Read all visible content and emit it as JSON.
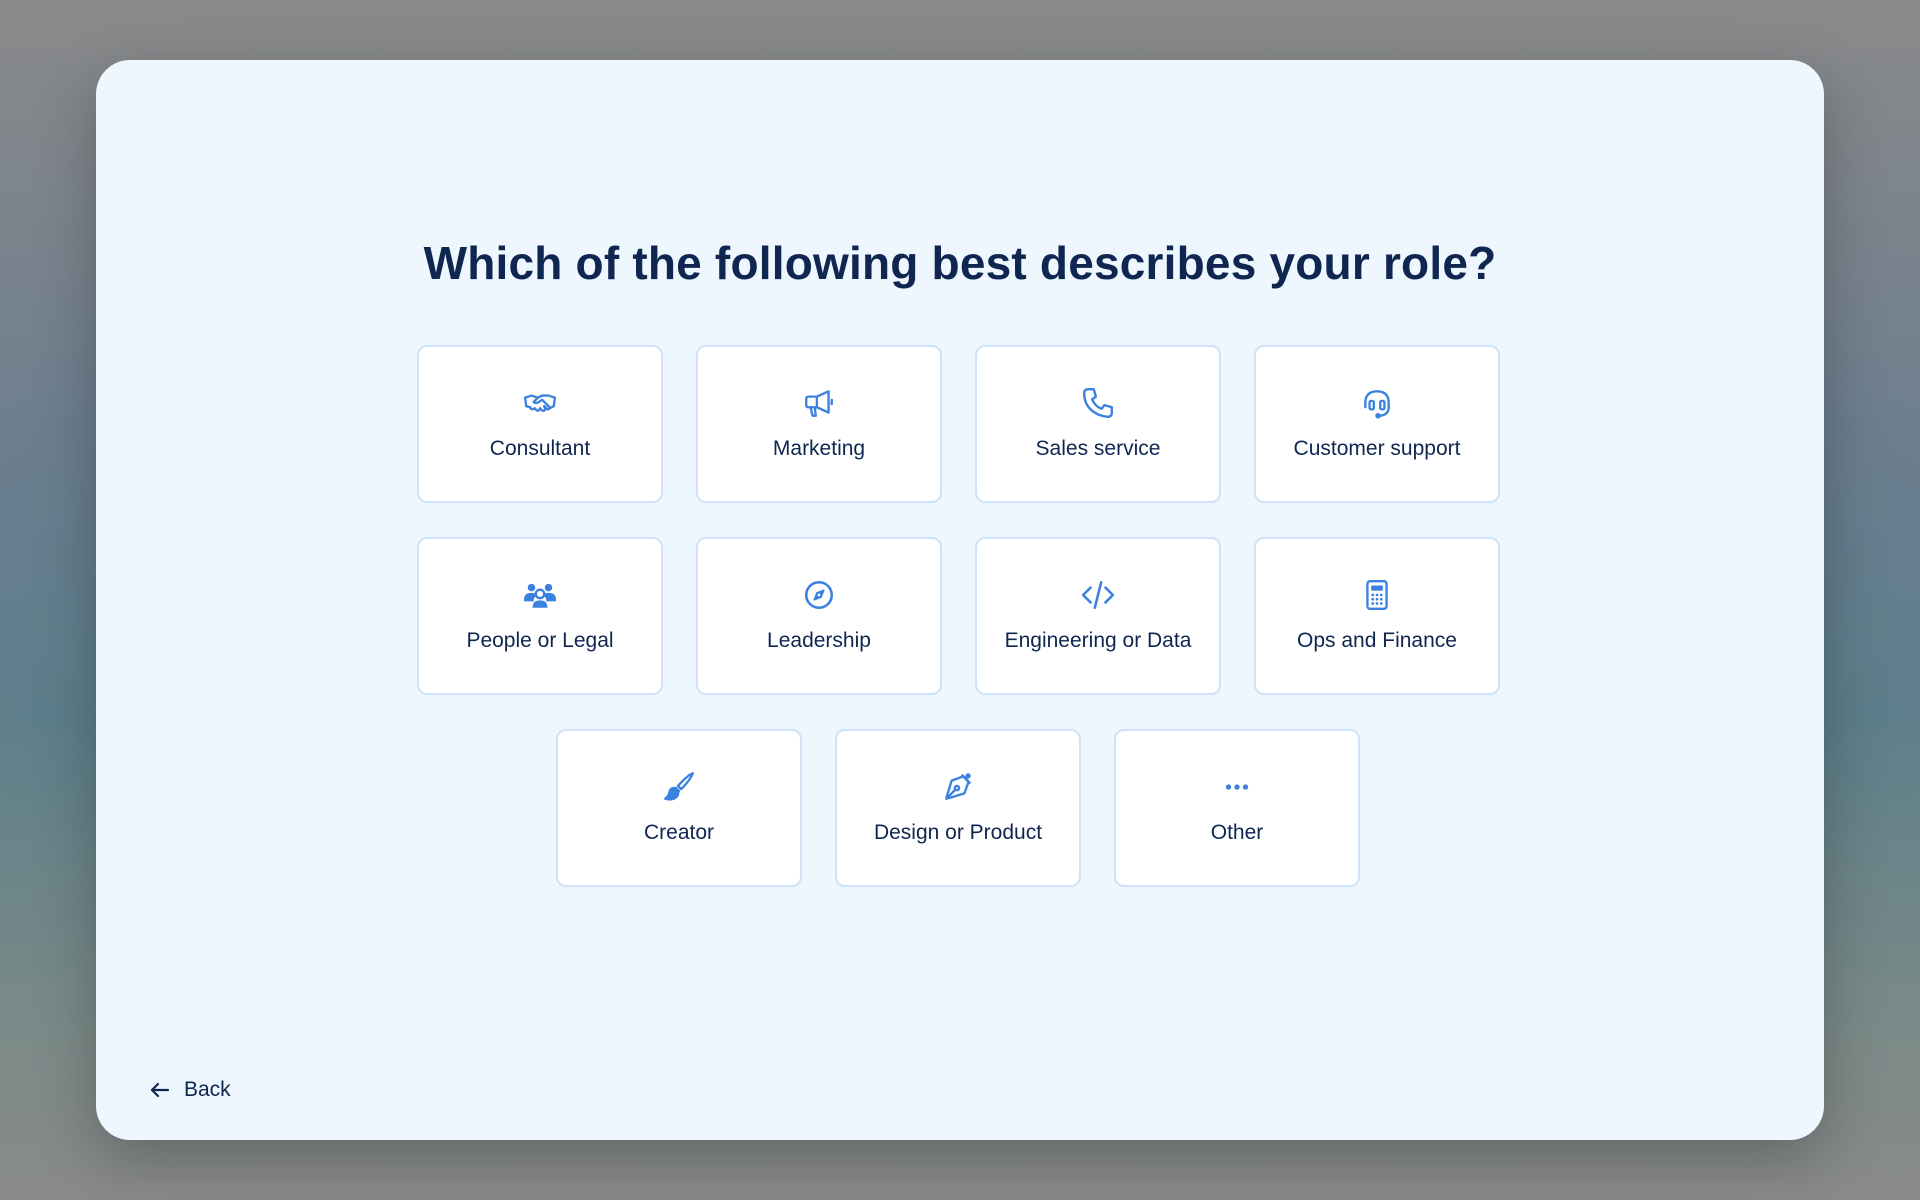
{
  "question": {
    "title": "Which of the following best describes your role?"
  },
  "roles": [
    {
      "label": "Consultant",
      "icon": "handshake-icon"
    },
    {
      "label": "Marketing",
      "icon": "megaphone-icon"
    },
    {
      "label": "Sales service",
      "icon": "phone-icon"
    },
    {
      "label": "Customer support",
      "icon": "headset-icon"
    },
    {
      "label": "People or Legal",
      "icon": "people-icon"
    },
    {
      "label": "Leadership",
      "icon": "compass-icon"
    },
    {
      "label": "Engineering or Data",
      "icon": "code-icon"
    },
    {
      "label": "Ops and Finance",
      "icon": "calculator-icon"
    },
    {
      "label": "Creator",
      "icon": "paintbrush-icon"
    },
    {
      "label": "Design or Product",
      "icon": "pen-nib-icon"
    },
    {
      "label": "Other",
      "icon": "more-dots-icon"
    }
  ],
  "navigation": {
    "back_label": "Back"
  },
  "colors": {
    "accent": "#3b82e0",
    "text": "#0f2650",
    "card_border": "#cfe2f7",
    "modal_bg": "#eef6fe"
  }
}
